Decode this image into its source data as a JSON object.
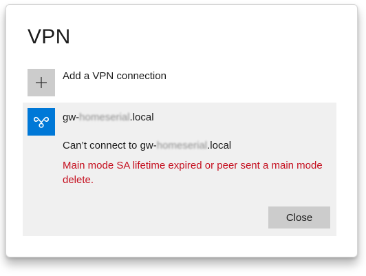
{
  "page": {
    "title": "VPN"
  },
  "add_connection": {
    "label": "Add a VPN connection",
    "icon": "plus-icon"
  },
  "vpn_connection": {
    "icon": "vpn-icon",
    "name_prefix": "gw-",
    "name_hidden": "homeserial",
    "name_suffix": ".local",
    "status_prefix": "Can’t connect to gw-",
    "status_hidden": "homeserial",
    "status_suffix": ".local",
    "error_message": "Main mode SA lifetime expired or peer sent a main mode delete.",
    "close_label": "Close"
  },
  "colors": {
    "accent": "#0078d7",
    "error": "#c50f1f",
    "tile_gray": "#cccccc",
    "item_background": "#f0f0f0"
  }
}
